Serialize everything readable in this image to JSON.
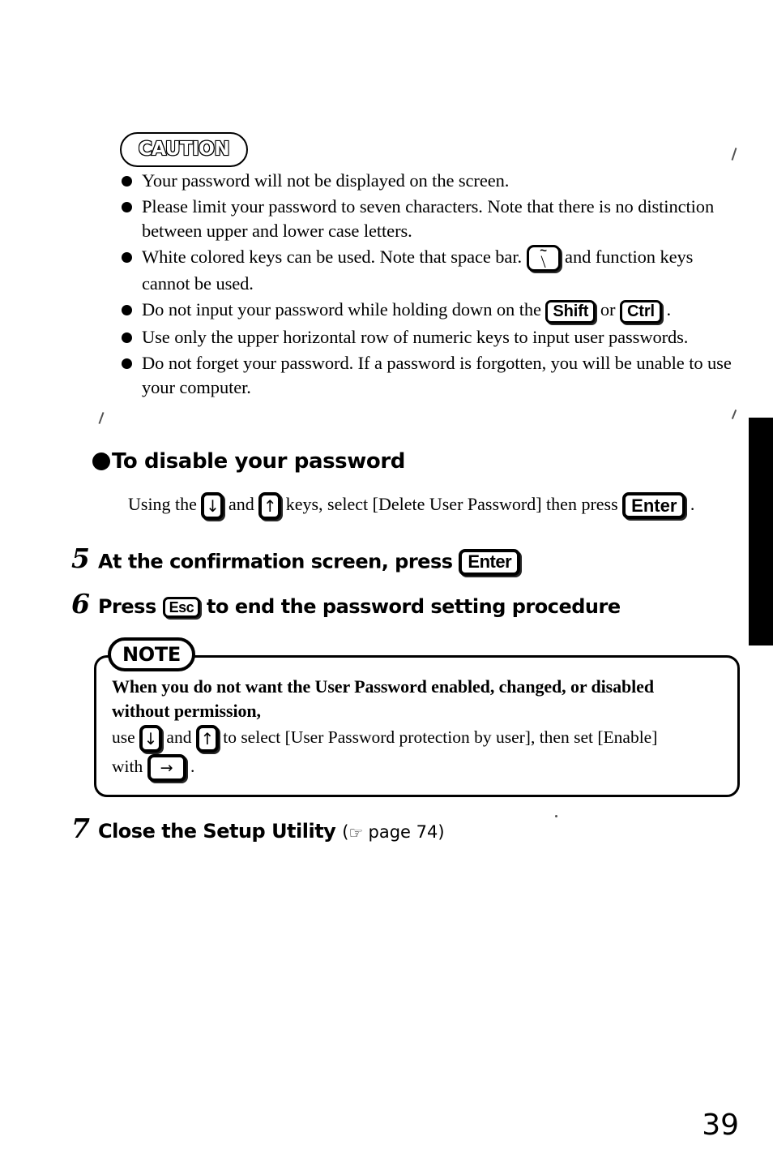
{
  "caution": {
    "header_label": "CAUTION",
    "bullets": [
      {
        "id": "no-display",
        "parts": [
          {
            "type": "text",
            "value": "Your password will not be displayed on the screen."
          }
        ]
      },
      {
        "id": "seven-chars",
        "parts": [
          {
            "type": "text",
            "value": "Please limit your password to seven characters.  Note that there is no distinction between upper and lower case letters."
          }
        ]
      },
      {
        "id": "white-keys",
        "parts": [
          {
            "type": "text",
            "value": "White colored keys can be used. Note that space bar. "
          },
          {
            "type": "key",
            "key_style": "tilde",
            "top_glyph": "~",
            "bottom_glyph": "\\"
          },
          {
            "type": "text",
            "value": " and function keys cannot be used."
          }
        ]
      },
      {
        "id": "shift-ctrl",
        "parts": [
          {
            "type": "text",
            "value": "Do not input your password while holding down on the "
          },
          {
            "type": "key",
            "key_style": "md",
            "label": "Shift"
          },
          {
            "type": "text",
            "value": " or "
          },
          {
            "type": "key",
            "key_style": "md",
            "label": "Ctrl"
          },
          {
            "type": "text",
            "value": " ."
          }
        ]
      },
      {
        "id": "numeric-row",
        "parts": [
          {
            "type": "text",
            "value": "Use only the upper horizontal row of numeric keys to input user passwords."
          }
        ]
      },
      {
        "id": "do-not-forget",
        "parts": [
          {
            "type": "text",
            "value": "Do not forget your password.  If a password is forgotten, you will be unable to use your computer."
          }
        ]
      }
    ]
  },
  "disable_section": {
    "heading": "To disable your password",
    "body_parts": [
      {
        "type": "text",
        "value": "Using the "
      },
      {
        "type": "key",
        "key_style": "arrow",
        "label": "↓"
      },
      {
        "type": "text",
        "value": " and "
      },
      {
        "type": "key",
        "key_style": "arrow",
        "label": "↑"
      },
      {
        "type": "text",
        "value": " keys, select [Delete User Password] then press "
      },
      {
        "type": "key",
        "key_style": "lg",
        "label": "Enter"
      },
      {
        "type": "text",
        "value": " ."
      }
    ]
  },
  "steps": [
    {
      "number": "5",
      "parts": [
        {
          "type": "text",
          "value": "At the confirmation screen, press "
        },
        {
          "type": "key",
          "key_style": "lg",
          "label": "Enter"
        }
      ]
    },
    {
      "number": "6",
      "parts": [
        {
          "type": "text",
          "value": "Press "
        },
        {
          "type": "key",
          "key_style": "sm",
          "label": "Esc"
        },
        {
          "type": "text",
          "value": " to end the password setting procedure"
        }
      ]
    },
    {
      "number": "7",
      "parts": [
        {
          "type": "text",
          "value": "Close the Setup Utility "
        },
        {
          "type": "pageref_open",
          "value": "("
        },
        {
          "type": "icon",
          "icon_name": "pointing-hand-icon",
          "glyph": "☞"
        },
        {
          "type": "pageref",
          "value": " page 74)"
        }
      ]
    }
  ],
  "note": {
    "tab_label": "NOTE",
    "lines": [
      {
        "style": "strong",
        "parts": [
          {
            "type": "text",
            "value": "When you do not want the User Password enabled, changed, or disabled"
          }
        ]
      },
      {
        "style": "strong",
        "parts": [
          {
            "type": "text",
            "value": "without permission,"
          }
        ]
      },
      {
        "style": "normal",
        "parts": [
          {
            "type": "text",
            "value": "use "
          },
          {
            "type": "key",
            "key_style": "arrow",
            "label": "↓"
          },
          {
            "type": "text",
            "value": " and "
          },
          {
            "type": "key",
            "key_style": "arrow",
            "label": "↑"
          },
          {
            "type": "text",
            "value": " to select [User Password protection by user], then set [Enable]"
          }
        ]
      },
      {
        "style": "normal",
        "parts": [
          {
            "type": "text",
            "value": "with "
          },
          {
            "type": "key",
            "key_style": "arrow-wide",
            "label": "→"
          },
          {
            "type": "text",
            "value": " ."
          }
        ]
      }
    ]
  },
  "page_number": "39",
  "colors": {
    "ink": "#000000",
    "paper": "#ffffff"
  }
}
